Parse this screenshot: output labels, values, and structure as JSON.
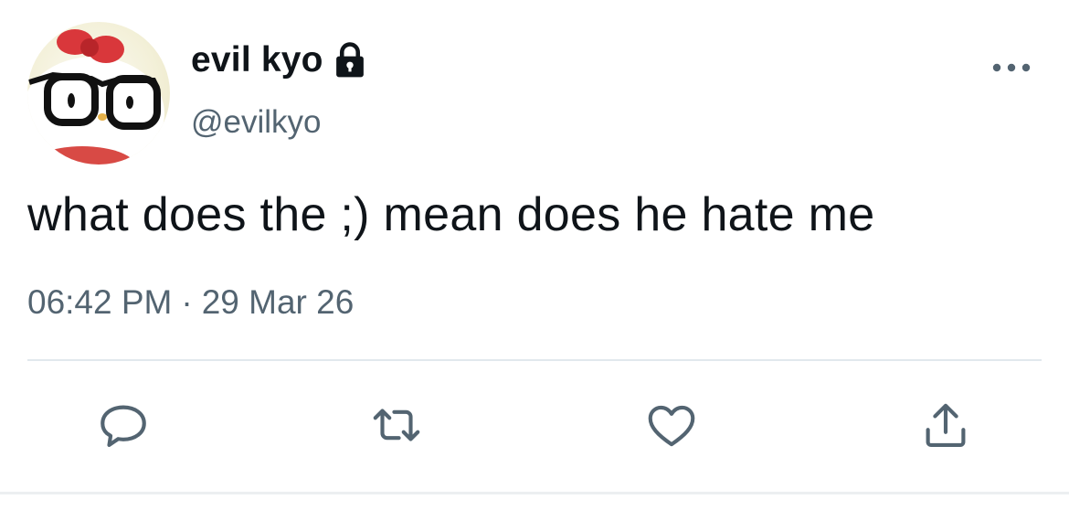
{
  "tweet": {
    "display_name": "evil kyo",
    "handle": "@evilkyo",
    "protected_icon": "lock-icon",
    "text": "what does the ;) mean does he hate me",
    "time": "06:42 PM",
    "separator": "·",
    "date": "29 Mar 26"
  },
  "actions": [
    {
      "icon": "reply-icon"
    },
    {
      "icon": "retweet-icon"
    },
    {
      "icon": "like-icon"
    },
    {
      "icon": "share-icon"
    }
  ],
  "colors": {
    "text_primary": "#0f1419",
    "text_secondary": "#536471",
    "divider": "#e1e8ed"
  }
}
